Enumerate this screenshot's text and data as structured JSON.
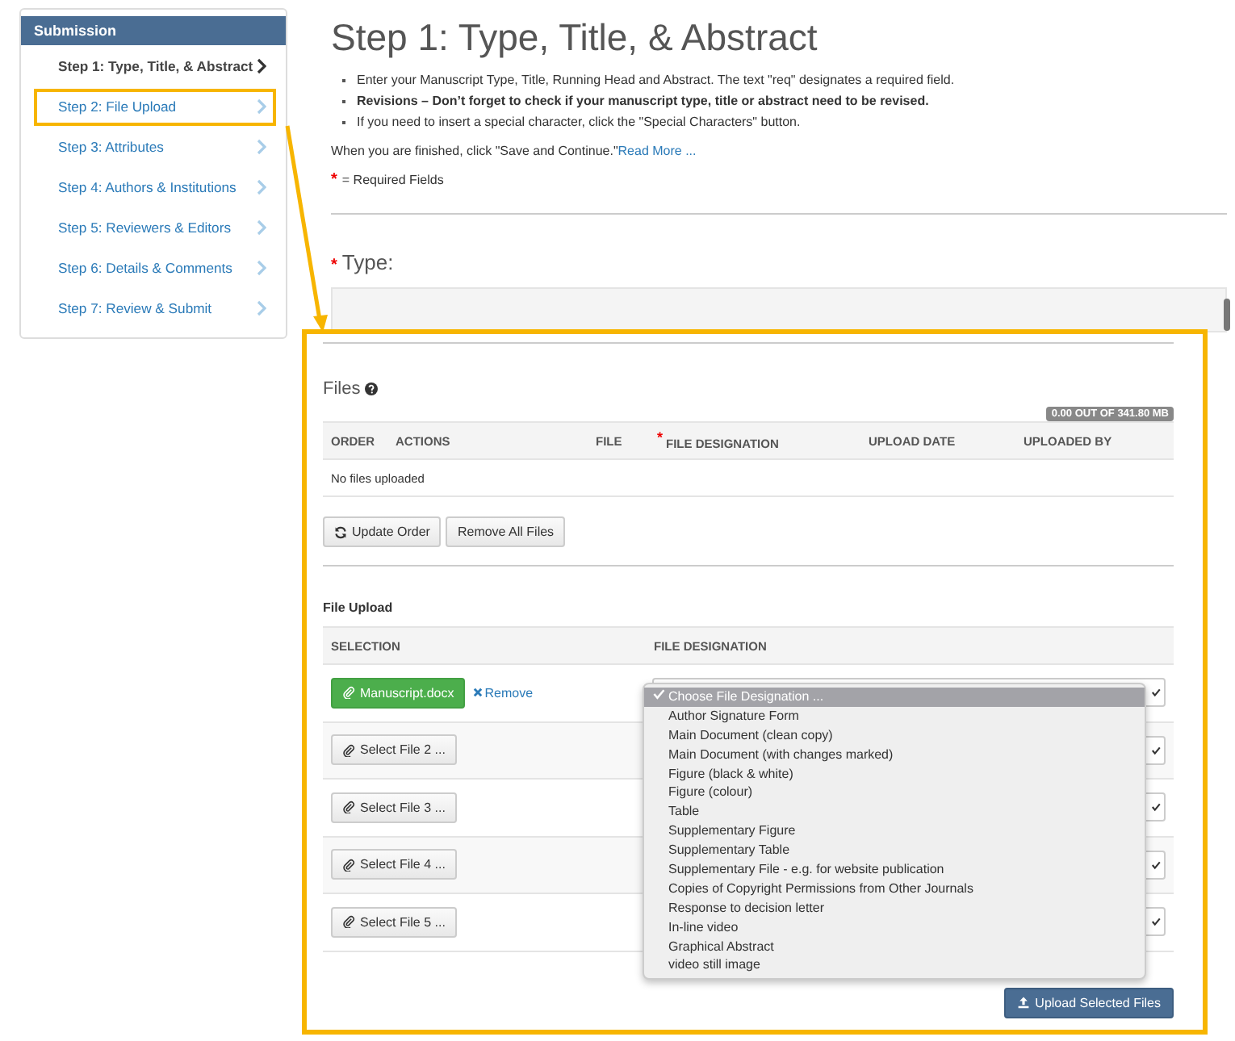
{
  "sidebar": {
    "title": "Submission",
    "items": [
      {
        "label": "Step 1: Type, Title, & Abstract",
        "selected": true,
        "highlighted": false
      },
      {
        "label": "Step 2: File Upload",
        "selected": false,
        "highlighted": true
      },
      {
        "label": "Step 3: Attributes",
        "selected": false,
        "highlighted": false
      },
      {
        "label": "Step 4: Authors & Institutions",
        "selected": false,
        "highlighted": false
      },
      {
        "label": "Step 5: Reviewers & Editors",
        "selected": false,
        "highlighted": false
      },
      {
        "label": "Step 6: Details & Comments",
        "selected": false,
        "highlighted": false
      },
      {
        "label": "Step 7: Review & Submit",
        "selected": false,
        "highlighted": false
      }
    ]
  },
  "page": {
    "title": "Step 1: Type, Title, & Abstract",
    "bullets": [
      {
        "text": "Enter your Manuscript Type, Title, Running Head and Abstract. The text \"req\" designates a required field.",
        "bold": false
      },
      {
        "text": "Revisions – Don’t forget to check if your manuscript type, title or abstract need to be revised.",
        "bold": true
      },
      {
        "text": "If you need to insert a special character, click the \"Special Characters\" button.",
        "bold": false
      }
    ],
    "finish_text": "When you are finished, click \"Save and Continue.\"",
    "read_more": "Read More ...",
    "required_mark": "*",
    "required_note": "= Required Fields",
    "type_mark": "*",
    "type_label": "Type:"
  },
  "callout": {
    "files_title": "Files",
    "quota": "0.00 OUT OF 341.80 MB",
    "files_columns": [
      {
        "label": "ORDER"
      },
      {
        "label": "ACTIONS"
      },
      {
        "label": "FILE"
      },
      {
        "label": "FILE DESIGNATION",
        "mark": "*"
      },
      {
        "label": "UPLOAD DATE"
      },
      {
        "label": "UPLOADED BY"
      }
    ],
    "empty_text": "No files uploaded",
    "buttons": [
      {
        "label": "Update Order",
        "kind": "refresh"
      },
      {
        "label": "Remove All Files",
        "kind": "plain"
      }
    ],
    "upload_title": "File Upload",
    "upload_columns": [
      "SELECTION",
      "FILE DESIGNATION"
    ],
    "upload_rows": [
      {
        "kind": "file",
        "label": "Manuscript.docx",
        "remove": "Remove"
      },
      {
        "kind": "empty",
        "label": "Select File 2 ..."
      },
      {
        "kind": "empty",
        "label": "Select File 3 ..."
      },
      {
        "kind": "empty",
        "label": "Select File 4 ..."
      },
      {
        "kind": "empty",
        "label": "Select File 5 ..."
      }
    ],
    "dropdown": {
      "options": [
        {
          "label": "Choose File Designation ...",
          "selected": true
        },
        {
          "label": "Author Signature Form",
          "selected": false
        },
        {
          "label": "Main Document (clean copy)",
          "selected": false
        },
        {
          "label": "Main Document (with changes marked)",
          "selected": false
        },
        {
          "label": "Figure (black & white)",
          "selected": false
        },
        {
          "label": "Figure (colour)",
          "selected": false
        },
        {
          "label": "Table",
          "selected": false
        },
        {
          "label": "Supplementary Figure",
          "selected": false
        },
        {
          "label": "Supplementary Table",
          "selected": false
        },
        {
          "label": "Supplementary File - e.g. for website publication",
          "selected": false
        },
        {
          "label": "Copies of Copyright Permissions from Other Journals",
          "selected": false
        },
        {
          "label": "Response to decision letter",
          "selected": false
        },
        {
          "label": "In-line video",
          "selected": false
        },
        {
          "label": "Graphical Abstract",
          "selected": false
        },
        {
          "label": "video still image",
          "selected": false
        }
      ]
    },
    "upload_button": "Upload Selected Files"
  }
}
